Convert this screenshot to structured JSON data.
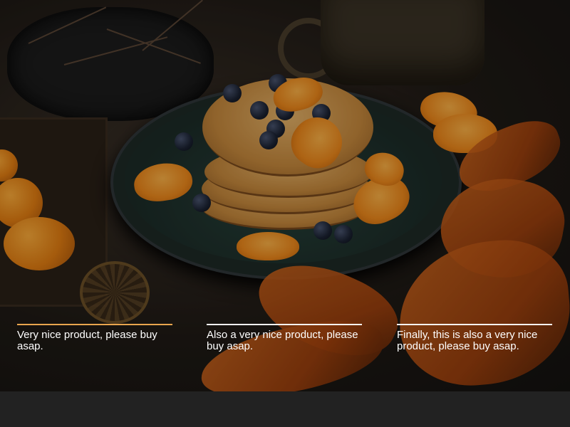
{
  "hero": {
    "image_subject": "pancake-stack-with-oranges-and-blueberries"
  },
  "features": [
    {
      "text": "Very nice product, please buy asap."
    },
    {
      "text": "Also a very nice product, please buy asap."
    },
    {
      "text": "Finally, this is also a very nice product, please buy asap."
    }
  ],
  "colors": {
    "caption_text": "#ffffff",
    "first_rule": "#e9a54e",
    "rule": "#f5f5f5",
    "footer": "#222222"
  }
}
